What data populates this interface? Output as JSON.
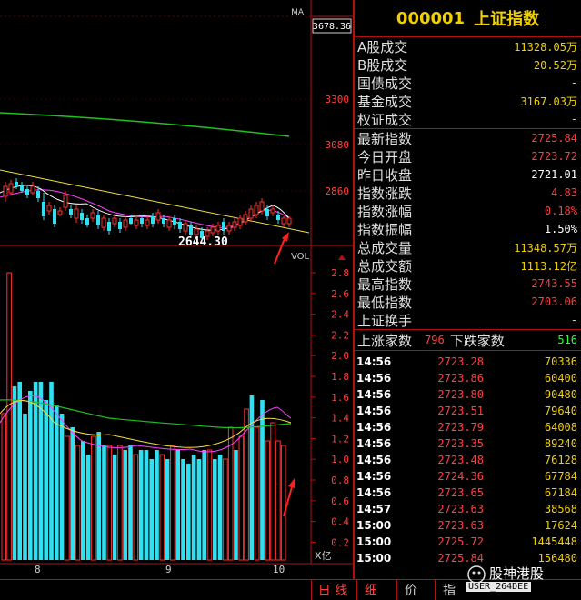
{
  "chart": {
    "price_high_marker": "3678.36",
    "price_axis": [
      "3300",
      "3080",
      "2860"
    ],
    "low_annotation": "2644.30",
    "vol_label": "VOL",
    "vol_axis": [
      "2.8",
      "2.6",
      "2.4",
      "2.2",
      "2.0",
      "1.8",
      "1.6",
      "1.4",
      "1.2",
      "1.0",
      "0.8",
      "0.6",
      "0.4",
      "0.2"
    ],
    "vol_unit": "X亿",
    "x_labels": [
      "8",
      "9",
      "10"
    ],
    "period_label": "日 线",
    "colors": {
      "up": "#ff3030",
      "down": "#30e0f0",
      "ma_white": "#ffffff",
      "ma_yellow": "#f0e040",
      "ma_magenta": "#ff40ff",
      "ma_green": "#20c020",
      "grid": "#800000",
      "arrow": "#ff2020"
    }
  },
  "quote": {
    "code": "000001",
    "name": "上证指数",
    "rows1": [
      {
        "label": "A股成交",
        "value": "11328.05万",
        "color": "c-yel"
      },
      {
        "label": "B股成交",
        "value": "20.52万",
        "color": "c-yel"
      },
      {
        "label": "国债成交",
        "value": "-",
        "color": "c-dim"
      },
      {
        "label": "基金成交",
        "value": "3167.03万",
        "color": "c-yel"
      },
      {
        "label": "权证成交",
        "value": "-",
        "color": "c-dim"
      }
    ],
    "rows2": [
      {
        "label": "最新指数",
        "value": "2725.84",
        "color": "c-red"
      },
      {
        "label": "今日开盘",
        "value": "2723.72",
        "color": "c-red"
      },
      {
        "label": "昨日收盘",
        "value": "2721.01",
        "color": "c-wht"
      },
      {
        "label": "指数涨跌",
        "value": "4.83",
        "color": "c-red"
      },
      {
        "label": "指数涨幅",
        "value": "0.18%",
        "color": "c-red"
      },
      {
        "label": "指数振幅",
        "value": "1.50%",
        "color": "c-wht"
      },
      {
        "label": "总成交量",
        "value": "11348.57万",
        "color": "c-yel"
      },
      {
        "label": "总成交额",
        "value": "1113.12亿",
        "color": "c-yel"
      },
      {
        "label": "最高指数",
        "value": "2743.55",
        "color": "c-red"
      },
      {
        "label": "最低指数",
        "value": "2703.06",
        "color": "c-red"
      },
      {
        "label": "上证换手",
        "value": "-",
        "color": "c-dim"
      }
    ],
    "up_label": "上涨家数",
    "up_count": "796",
    "down_label": "下跌家数",
    "down_count": "516",
    "ticks": [
      {
        "time": "14:56",
        "price": "2723.28",
        "vol": "70336"
      },
      {
        "time": "14:56",
        "price": "2723.86",
        "vol": "60400"
      },
      {
        "time": "14:56",
        "price": "2723.80",
        "vol": "90480"
      },
      {
        "time": "14:56",
        "price": "2723.51",
        "vol": "79640"
      },
      {
        "time": "14:56",
        "price": "2723.79",
        "vol": "64008"
      },
      {
        "time": "14:56",
        "price": "2723.35",
        "vol": "89240"
      },
      {
        "time": "14:56",
        "price": "2723.48",
        "vol": "76128"
      },
      {
        "time": "14:56",
        "price": "2724.36",
        "vol": "67784"
      },
      {
        "time": "14:56",
        "price": "2723.65",
        "vol": "67184"
      },
      {
        "time": "14:57",
        "price": "2723.63",
        "vol": "38568"
      },
      {
        "time": "15:00",
        "price": "2723.63",
        "vol": "17624"
      },
      {
        "time": "15:00",
        "price": "2725.72",
        "vol": "1445448"
      },
      {
        "time": "15:00",
        "price": "2725.84",
        "vol": "156480"
      }
    ]
  },
  "tabs": [
    "细",
    "价",
    "指"
  ],
  "watermark": {
    "text": "股神港股",
    "user": "USER_264DEE"
  }
}
